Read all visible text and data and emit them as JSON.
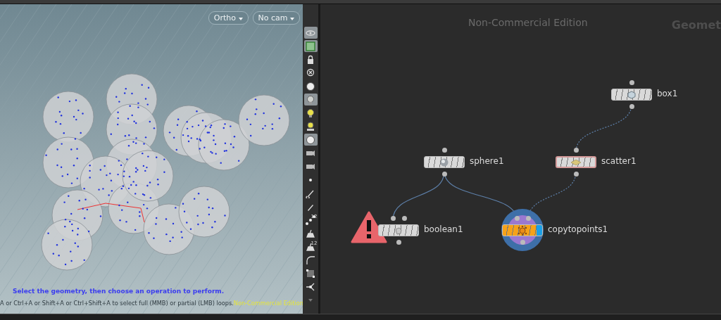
{
  "viewport": {
    "view_buttons": [
      {
        "label": "Ortho"
      },
      {
        "label": "No cam"
      }
    ],
    "prompt": "Select the geometry, then choose an operation to perform.",
    "hint": "A or Ctrl+A or Shift+A or Ctrl+Shift+A to select full (MMB) or partial (LMB) loops.",
    "edition": "Non-Commercial Edition"
  },
  "toolbar": [
    {
      "kind": "eye",
      "selected": true
    },
    {
      "kind": "frame",
      "selected": true
    },
    {
      "kind": "lock",
      "selected": false
    },
    {
      "kind": "bulb-off",
      "selected": false
    },
    {
      "kind": "ball",
      "selected": false
    },
    {
      "kind": "bulb",
      "selected": true
    },
    {
      "kind": "bulb-lit",
      "selected": false
    },
    {
      "kind": "bulb-base",
      "selected": false
    },
    {
      "kind": "ball",
      "selected": true
    },
    {
      "kind": "camera",
      "selected": false
    },
    {
      "kind": "camera",
      "selected": false
    },
    {
      "kind": "dot",
      "selected": false
    },
    {
      "kind": "brush",
      "selected": false
    },
    {
      "kind": "pen",
      "selected": false
    },
    {
      "kind": "points",
      "label": "12",
      "selected": false
    },
    {
      "kind": "paint",
      "selected": false
    },
    {
      "kind": "paint",
      "label": "12",
      "selected": false
    },
    {
      "kind": "curve",
      "selected": false
    },
    {
      "kind": "grid",
      "selected": false
    },
    {
      "kind": "axis",
      "selected": false
    },
    {
      "kind": "more",
      "selected": false
    }
  ],
  "network": {
    "watermark": "Non-Commercial Edition",
    "title": "Geomet",
    "nodes": [
      {
        "name": "box1",
        "kind": "box",
        "selected": false,
        "error": false,
        "display": false
      },
      {
        "name": "sphere1",
        "kind": "sphere",
        "selected": false,
        "error": false,
        "display": false
      },
      {
        "name": "scatter1",
        "kind": "scatter",
        "selected": true,
        "error": false,
        "display": false
      },
      {
        "name": "boolean1",
        "kind": "boolean",
        "selected": false,
        "error": true,
        "display": false
      },
      {
        "name": "copytopoints1",
        "kind": "copy",
        "selected": false,
        "error": false,
        "display": true
      }
    ],
    "links": [
      {
        "dotted": true
      },
      {
        "dotted": false
      },
      {
        "dotted": false
      },
      {
        "dotted": true
      }
    ]
  }
}
